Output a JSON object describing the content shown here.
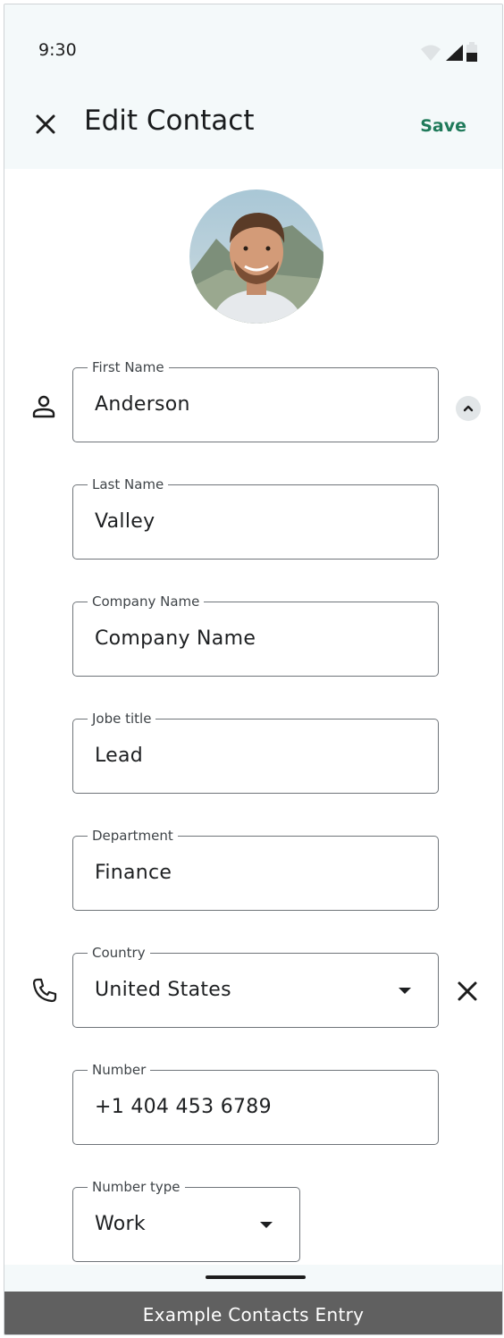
{
  "status_bar": {
    "time": "9:30",
    "icons": [
      "wifi-icon",
      "signal-icon",
      "battery-icon"
    ]
  },
  "app_bar": {
    "close_icon": "close-icon",
    "title": "Edit Contact",
    "save_label": "Save"
  },
  "avatar": {
    "description_icon": "profile-photo"
  },
  "fields": {
    "first_name": {
      "label": "First Name",
      "value": "Anderson"
    },
    "last_name": {
      "label": "Last Name",
      "value": "Valley"
    },
    "company": {
      "label": "Company Name",
      "value": "Company Name"
    },
    "job_title": {
      "label": "Jobe title",
      "value": "Lead"
    },
    "department": {
      "label": "Department",
      "value": "Finance"
    },
    "country": {
      "label": "Country",
      "value": "United States"
    },
    "number": {
      "label": "Number",
      "value": "+1 404 453 6789"
    },
    "number_type": {
      "label": "Number type",
      "value": "Work"
    }
  },
  "icons": {
    "person": "person-icon",
    "phone": "phone-icon",
    "collapse": "chevron-up-icon",
    "remove": "close-icon",
    "dropdown": "arrow-drop-down-icon"
  },
  "colors": {
    "accent": "#1f7a5a",
    "surface": "#f4f9fa",
    "caption_bg": "#606060"
  },
  "caption": "Example Contacts Entry"
}
